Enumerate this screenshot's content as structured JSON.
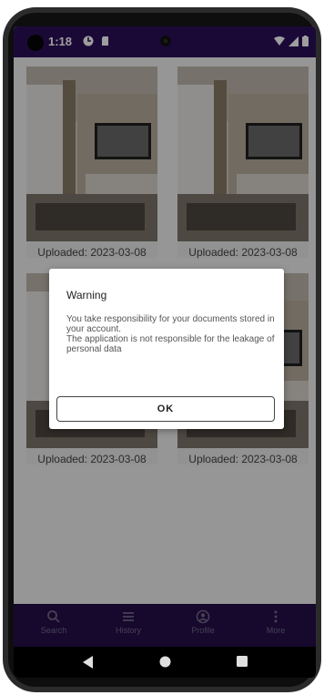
{
  "status_bar": {
    "time": "1:18"
  },
  "cards": [
    {
      "caption": "Uploaded: 2023-03-08"
    },
    {
      "caption": "Uploaded: 2023-03-08"
    },
    {
      "caption": "Uploaded: 2023-03-08"
    },
    {
      "caption": "Uploaded: 2023-03-08"
    }
  ],
  "dialog": {
    "title": "Warning",
    "body": "You take responsibility for your documents stored in your account.\nThe application is not responsible for the leakage of personal data",
    "ok_label": "OK"
  },
  "bottom_nav": {
    "items": [
      {
        "label": "Search",
        "icon": "search-icon"
      },
      {
        "label": "History",
        "icon": "list-icon"
      },
      {
        "label": "Profile",
        "icon": "account-icon"
      },
      {
        "label": "More",
        "icon": "more-vertical-icon"
      }
    ]
  },
  "system_nav": {
    "buttons": [
      "back-icon",
      "home-icon",
      "recents-icon"
    ]
  },
  "colors": {
    "status_bar": "#2a0f5a",
    "bottom_nav": "#3a1a78",
    "scrim": "rgba(0,0,0,0.38)"
  }
}
